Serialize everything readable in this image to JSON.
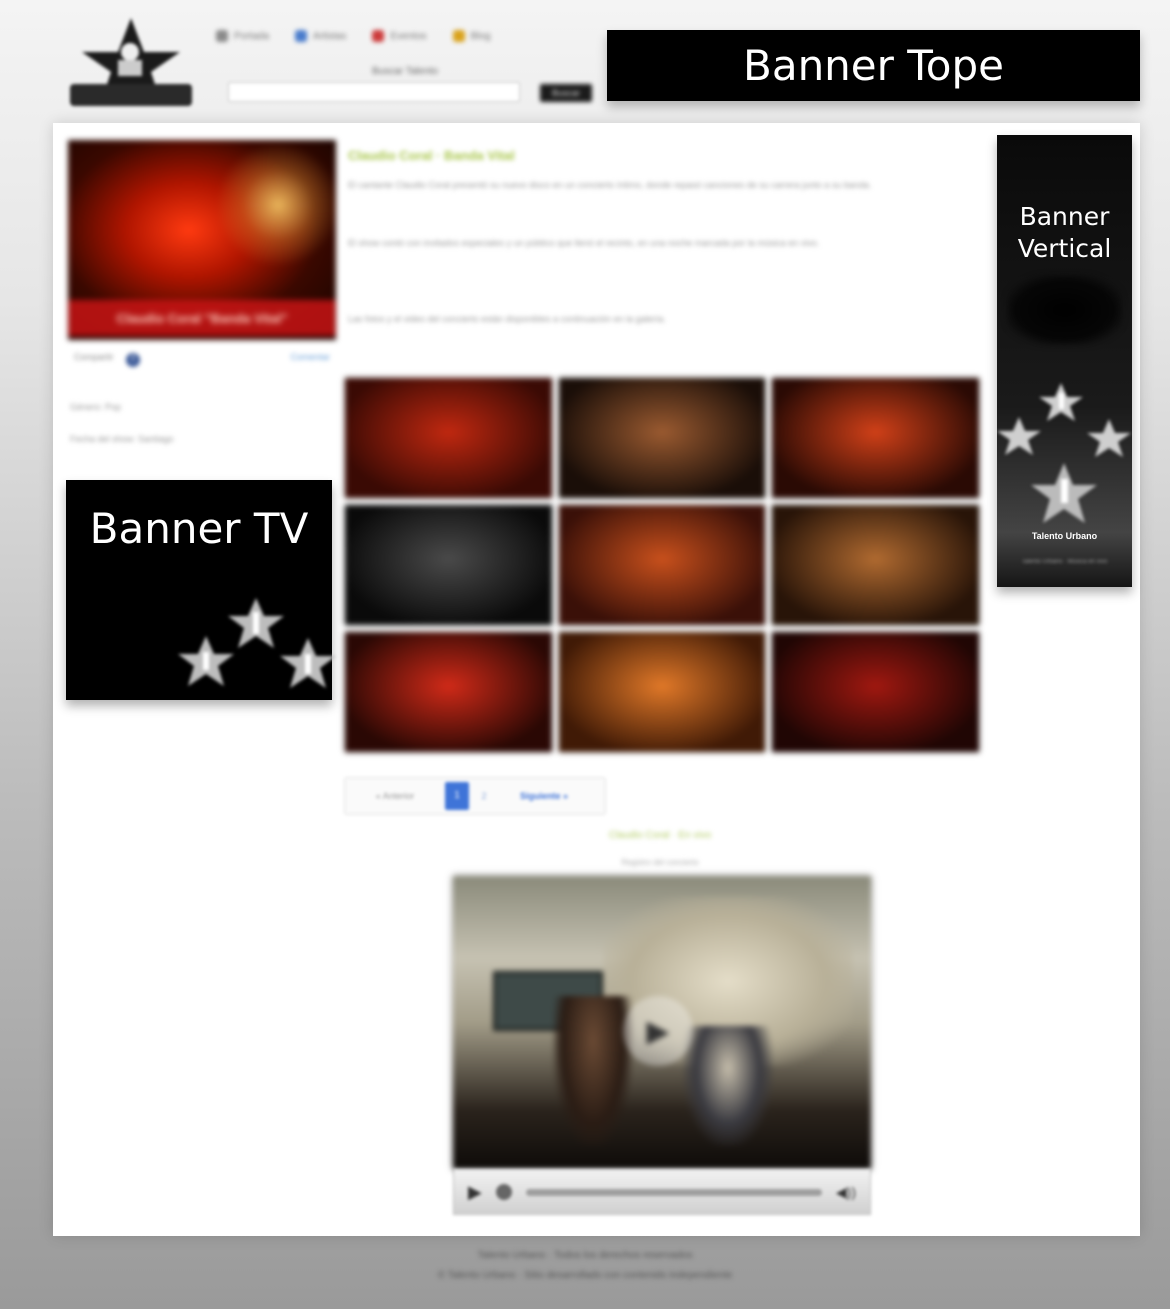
{
  "header": {
    "nav_items": [
      {
        "label": "Portada",
        "icon": "home-icon",
        "color": "#8a8a8a"
      },
      {
        "label": "Artistas",
        "icon": "user-icon",
        "color": "#4a7ccc"
      },
      {
        "label": "Eventos",
        "icon": "heart-icon",
        "color": "#cc3b3b"
      },
      {
        "label": "Blog",
        "icon": "star-icon",
        "color": "#d9a21b"
      }
    ],
    "search_label": "Buscar Talento",
    "search_placeholder": "",
    "search_button_label": "Buscar"
  },
  "banners": {
    "top": "Banner Tope",
    "tv": "Banner TV",
    "vertical_line1": "Banner",
    "vertical_line2": "Vertical",
    "vertical_logo_text": "Talento Urbano",
    "vertical_tagline": "Talento Urbano · Música en vivo"
  },
  "artist": {
    "photo_caption": "Claudio Coral \"Banda Vital\"",
    "share_left": "Compartir",
    "share_right": "Comentar",
    "side_link_1": "Género: Pop",
    "side_link_2": "Fecha del show: Santiago"
  },
  "article": {
    "title": "Claudio Coral · Banda Vital",
    "p1": "El cantante Claudio Coral presentó su nuevo disco en un concierto íntimo, donde repasó canciones de su carrera junto a su banda.",
    "p2": "El show contó con invitados especiales y un público que llenó el recinto, en una noche marcada por la música en vivo.",
    "p3": "Las fotos y el video del concierto están disponibles a continuación en la galería."
  },
  "gallery": {
    "photos": [
      {
        "alt": "show-foto-1",
        "colors": [
          "#c02810",
          "#3a0a04"
        ]
      },
      {
        "alt": "show-foto-2",
        "colors": [
          "#9a5a30",
          "#1a0e08"
        ]
      },
      {
        "alt": "show-foto-3",
        "colors": [
          "#d04018",
          "#2a0a04"
        ]
      },
      {
        "alt": "show-foto-4",
        "colors": [
          "#4a4a4a",
          "#0a0a0a"
        ]
      },
      {
        "alt": "show-foto-5",
        "colors": [
          "#c8501c",
          "#3a1008"
        ]
      },
      {
        "alt": "show-foto-6",
        "colors": [
          "#b06a30",
          "#281408"
        ]
      },
      {
        "alt": "show-foto-7",
        "colors": [
          "#d02a18",
          "#2a0804"
        ]
      },
      {
        "alt": "show-foto-8",
        "colors": [
          "#e07828",
          "#401a06"
        ]
      },
      {
        "alt": "show-foto-9",
        "colors": [
          "#a01810",
          "#200604"
        ]
      }
    ]
  },
  "pager": {
    "prev_label": "« Anterior",
    "current_page": "1",
    "next_page": "2",
    "next_label": "Siguiente »"
  },
  "video": {
    "title": "Claudio Coral · En vivo",
    "subtitle": "Registro del concierto",
    "play_symbol": "▶",
    "volume_symbol": "◀))"
  },
  "footer": {
    "line1": "Talento Urbano · Todos los derechos reservados",
    "line2": "© Talento Urbano · Sitio desarrollado con contenido independiente"
  }
}
